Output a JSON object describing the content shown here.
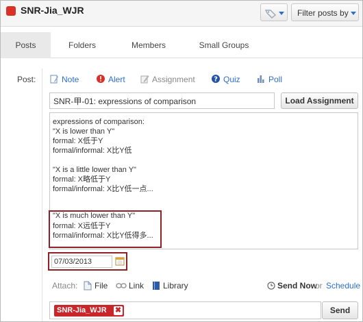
{
  "header": {
    "group_name": "SNR-Jia_WJR",
    "filter_label": "Filter posts by"
  },
  "tabs": [
    {
      "label": "Posts",
      "active": true
    },
    {
      "label": "Folders"
    },
    {
      "label": "Members"
    },
    {
      "label": "Small Groups"
    }
  ],
  "composer": {
    "post_label": "Post:",
    "types": {
      "note": "Note",
      "alert": "Alert",
      "assignment": "Assignment",
      "quiz": "Quiz",
      "poll": "Poll"
    },
    "title_value": "SNR-甲-01: expressions of comparison",
    "load_assignment_label": "Load Assignment",
    "body_lines": [
      "expressions of comparison:",
      "\"X is lower than Y\"",
      "formal: X低于Y",
      "formal/informal: X比Y低",
      "",
      "\"X is a little lower than Y\"",
      "formal: X略低于Y",
      "formal/informal: X比Y低一点...",
      "",
      "\"X is much lower than Y\"",
      "formal: X远低于Y",
      "formal/informal: X比Y低得多..."
    ],
    "due_date": "07/03/2013",
    "attach": {
      "label": "Attach:",
      "file": "File",
      "link": "Link",
      "library": "Library"
    },
    "send_now": "Send Now",
    "or": "or",
    "schedule": "Schedule",
    "recipient": "SNR-Jia_WJR",
    "send_label": "Send"
  },
  "colors": {
    "accent_blue": "#2d6fd0",
    "brand_red": "#d9302a",
    "highlight_border": "#8f2124"
  }
}
